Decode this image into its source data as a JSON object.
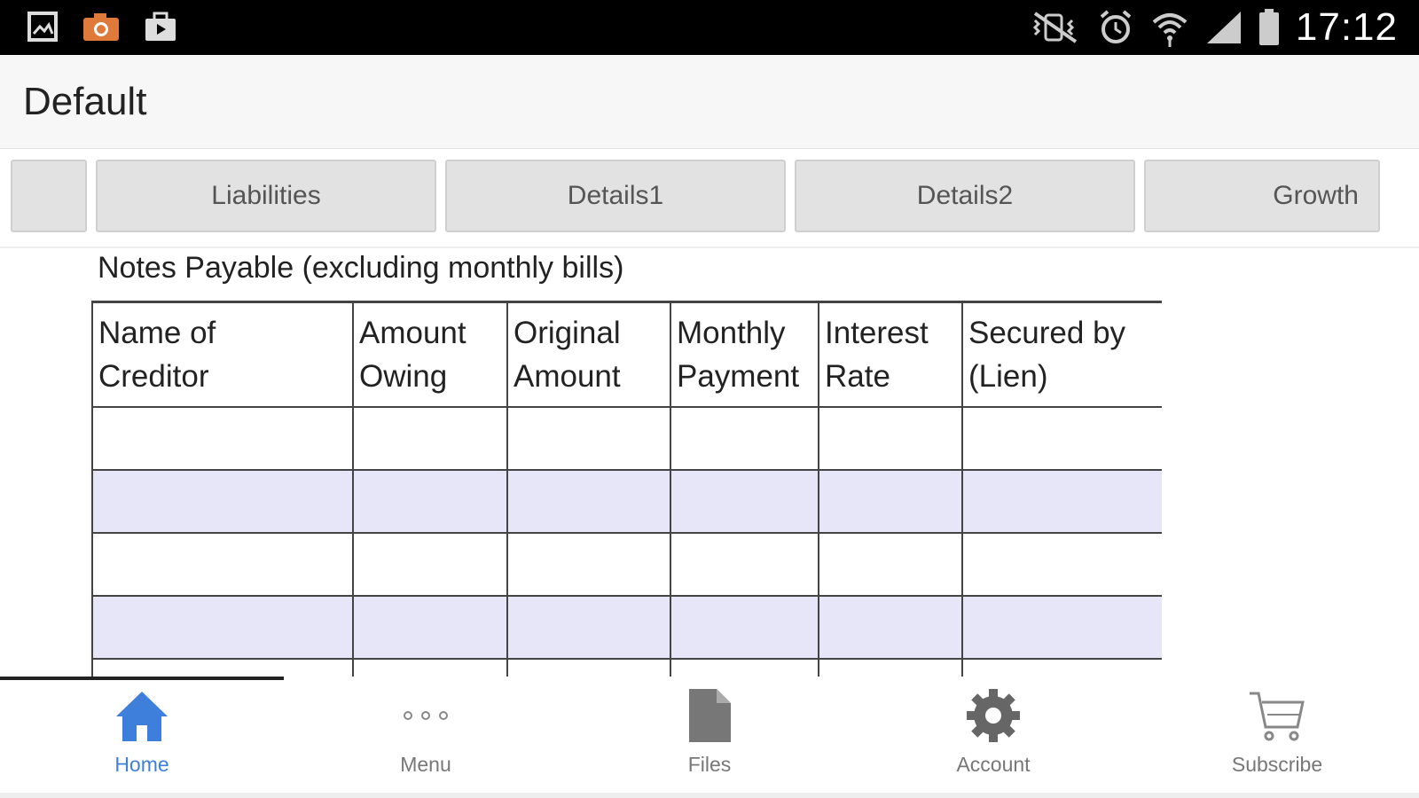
{
  "status_bar": {
    "time": "17:12",
    "left_icons": [
      "gallery-icon",
      "camera-icon",
      "briefcase-icon"
    ],
    "right_icons": [
      "vibrate-mute-icon",
      "alarm-icon",
      "wifi-icon",
      "signal-icon",
      "battery-icon"
    ]
  },
  "app_bar": {
    "title": "Default"
  },
  "tabs": [
    {
      "label": ""
    },
    {
      "label": "Liabilities"
    },
    {
      "label": "Details1"
    },
    {
      "label": "Details2"
    },
    {
      "label": "Growth"
    }
  ],
  "section": {
    "title": "Notes Payable (excluding monthly bills)",
    "columns": [
      {
        "line1": "Name of",
        "line2": "Creditor"
      },
      {
        "line1": "Amount",
        "line2": "Owing"
      },
      {
        "line1": "Original",
        "line2": "Amount"
      },
      {
        "line1": "Monthly",
        "line2": "Payment"
      },
      {
        "line1": "Interest",
        "line2": "Rate"
      },
      {
        "line1": "Secured by",
        "line2": "(Lien)"
      }
    ],
    "rows": [
      [
        "",
        "",
        "",
        "",
        "",
        ""
      ],
      [
        "",
        "",
        "",
        "",
        "",
        ""
      ],
      [
        "",
        "",
        "",
        "",
        "",
        ""
      ],
      [
        "",
        "",
        "",
        "",
        "",
        ""
      ],
      [
        "",
        "",
        "",
        "",
        "",
        ""
      ]
    ]
  },
  "bottom_nav": {
    "items": [
      {
        "label": "Home",
        "icon": "home-icon",
        "active": true
      },
      {
        "label": "Menu",
        "icon": "more-dots-icon"
      },
      {
        "label": "Files",
        "icon": "file-icon"
      },
      {
        "label": "Account",
        "icon": "gear-icon"
      },
      {
        "label": "Subscribe",
        "icon": "cart-icon"
      }
    ]
  },
  "colors": {
    "accent": "#3f7fdc",
    "row_alt": "#e6e6f8",
    "tab_bg": "#e2e2e2",
    "status_bar": "#000000"
  }
}
